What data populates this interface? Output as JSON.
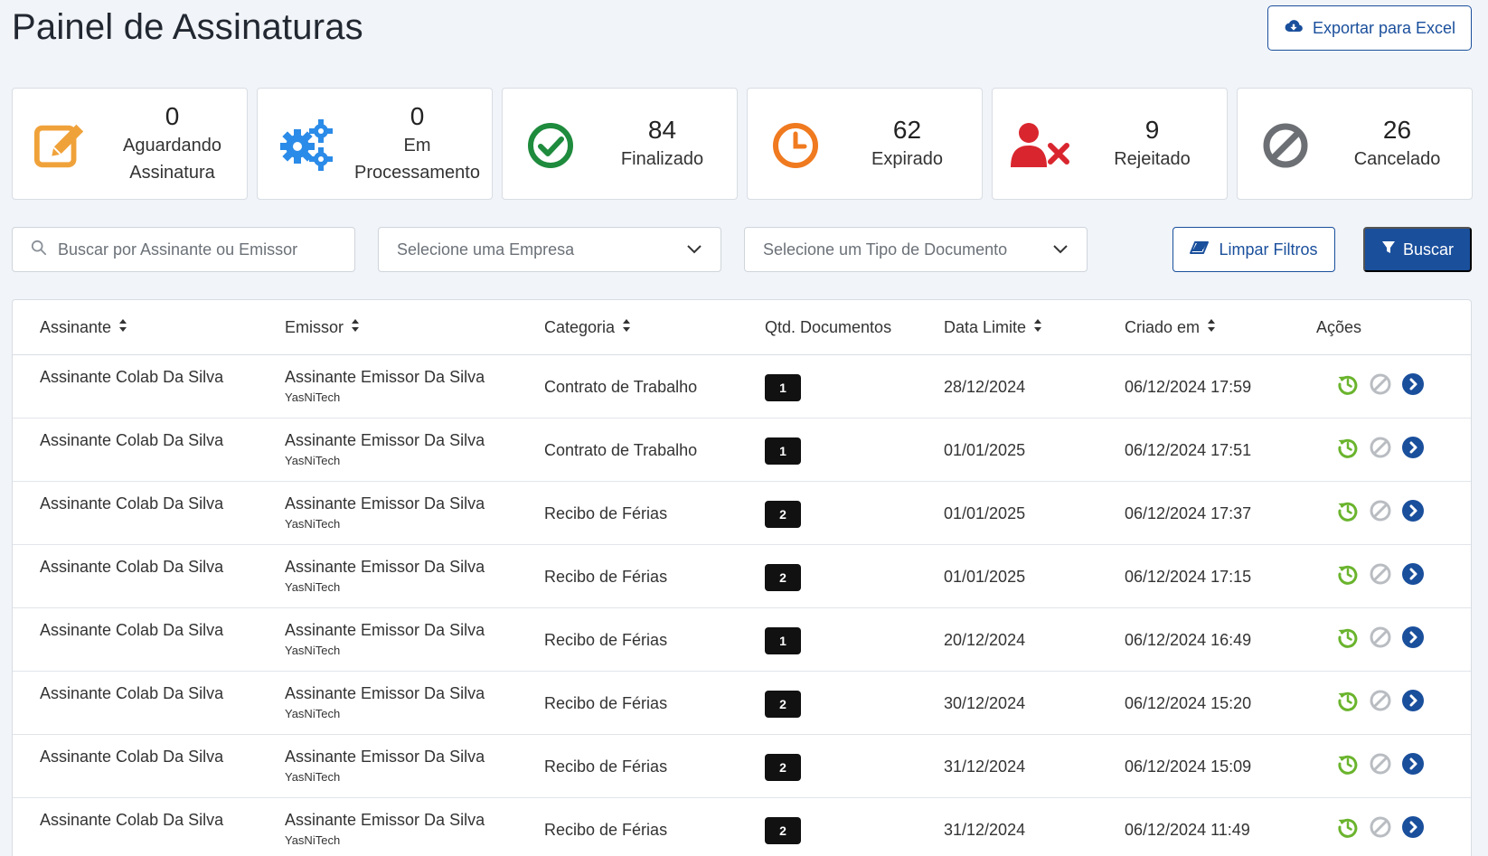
{
  "page": {
    "title": "Painel de Assinaturas"
  },
  "toolbar": {
    "export_label": "Exportar para Excel"
  },
  "cards": [
    {
      "count": "0",
      "label_line1": "Aguardando",
      "label_line2": "Assinatura",
      "icon": "pencil-square-icon",
      "color": "#f0a23a"
    },
    {
      "count": "0",
      "label_line1": "Em",
      "label_line2": "Processamento",
      "icon": "gears-icon",
      "color": "#2b8be8"
    },
    {
      "count": "84",
      "label_line1": "Finalizado",
      "label_line2": "",
      "icon": "check-circle-icon",
      "color": "#1e8b3d"
    },
    {
      "count": "62",
      "label_line1": "Expirado",
      "label_line2": "",
      "icon": "clock-icon",
      "color": "#f07a1f"
    },
    {
      "count": "9",
      "label_line1": "Rejeitado",
      "label_line2": "",
      "icon": "user-x-icon",
      "color": "#d9262e"
    },
    {
      "count": "26",
      "label_line1": "Cancelado",
      "label_line2": "",
      "icon": "ban-icon",
      "color": "#6c6f73"
    }
  ],
  "filters": {
    "search_placeholder": "Buscar por Assinante ou Emissor",
    "company_placeholder": "Selecione uma Empresa",
    "doctype_placeholder": "Selecione um Tipo de Documento",
    "clear_label": "Limpar Filtros",
    "search_label": "Buscar"
  },
  "table": {
    "headers": {
      "signer": "Assinante",
      "emitter": "Emissor",
      "category": "Categoria",
      "qty": "Qtd. Documentos",
      "deadline": "Data Limite",
      "created": "Criado em",
      "actions": "Ações"
    },
    "rows": [
      {
        "signer": "Assinante Colab Da Silva",
        "emitter": "Assinante Emissor Da Silva",
        "company": "YasNiTech",
        "category": "Contrato de Trabalho",
        "qty": "1",
        "deadline": "28/12/2024",
        "created": "06/12/2024 17:59"
      },
      {
        "signer": "Assinante Colab Da Silva",
        "emitter": "Assinante Emissor Da Silva",
        "company": "YasNiTech",
        "category": "Contrato de Trabalho",
        "qty": "1",
        "deadline": "01/01/2025",
        "created": "06/12/2024 17:51"
      },
      {
        "signer": "Assinante Colab Da Silva",
        "emitter": "Assinante Emissor Da Silva",
        "company": "YasNiTech",
        "category": "Recibo de Férias",
        "qty": "2",
        "deadline": "01/01/2025",
        "created": "06/12/2024 17:37"
      },
      {
        "signer": "Assinante Colab Da Silva",
        "emitter": "Assinante Emissor Da Silva",
        "company": "YasNiTech",
        "category": "Recibo de Férias",
        "qty": "2",
        "deadline": "01/01/2025",
        "created": "06/12/2024 17:15"
      },
      {
        "signer": "Assinante Colab Da Silva",
        "emitter": "Assinante Emissor Da Silva",
        "company": "YasNiTech",
        "category": "Recibo de Férias",
        "qty": "1",
        "deadline": "20/12/2024",
        "created": "06/12/2024 16:49"
      },
      {
        "signer": "Assinante Colab Da Silva",
        "emitter": "Assinante Emissor Da Silva",
        "company": "YasNiTech",
        "category": "Recibo de Férias",
        "qty": "2",
        "deadline": "30/12/2024",
        "created": "06/12/2024 15:20"
      },
      {
        "signer": "Assinante Colab Da Silva",
        "emitter": "Assinante Emissor Da Silva",
        "company": "YasNiTech",
        "category": "Recibo de Férias",
        "qty": "2",
        "deadline": "31/12/2024",
        "created": "06/12/2024 15:09"
      },
      {
        "signer": "Assinante Colab Da Silva",
        "emitter": "Assinante Emissor Da Silva",
        "company": "YasNiTech",
        "category": "Recibo de Férias",
        "qty": "2",
        "deadline": "31/12/2024",
        "created": "06/12/2024 11:49"
      }
    ],
    "row_actions": [
      "history-icon",
      "cancel-icon",
      "open-details-icon"
    ]
  },
  "colors": {
    "primary": "#1a4f9c",
    "history_green": "#6ab42d",
    "disabled_gray": "#b9bdc2"
  }
}
